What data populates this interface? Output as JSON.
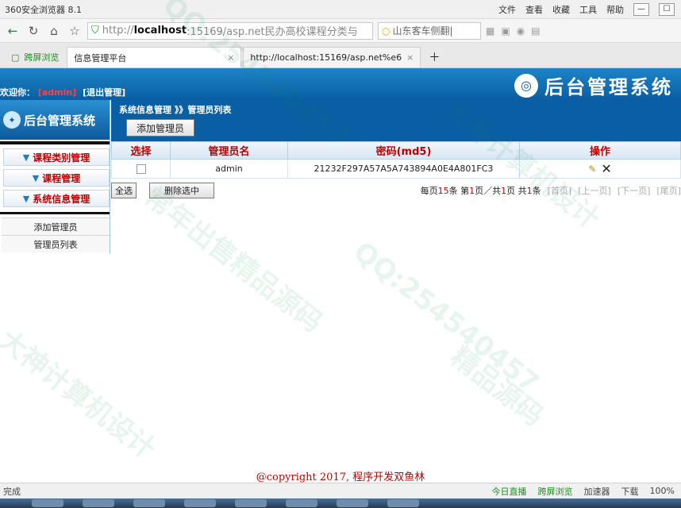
{
  "browser": {
    "app_title": "360安全浏览器 8.1",
    "menu": [
      "文件",
      "查看",
      "收藏",
      "工具",
      "帮助"
    ],
    "address_scheme": "http://",
    "address_host": "localhost",
    "address_rest": ":15169/asp.net民办高校课程分类与",
    "search_text": "山东客车侧翻|",
    "tabs": [
      {
        "label": "跨屏浏览"
      },
      {
        "label": "信息管理平台"
      },
      {
        "label": "http://localhost:15169/asp.net%e6"
      }
    ],
    "status_left": "完成",
    "status_right": [
      "今日直播",
      "跨屏浏览",
      "加速器",
      "下载",
      "100%"
    ]
  },
  "header": {
    "welcome_prefix": "欢迎你：",
    "welcome_user": "[admin]",
    "logout": "[退出管理]",
    "brand_title": "后台管理系统"
  },
  "sidebar": {
    "logo_title": "后台管理系统",
    "categories": [
      {
        "label": "课程类别管理"
      },
      {
        "label": "课程管理"
      },
      {
        "label": "系统信息管理"
      }
    ],
    "links": [
      {
        "label": "添加管理员"
      },
      {
        "label": "管理员列表"
      }
    ]
  },
  "main": {
    "breadcrumb": "系统信息管理 》》管理员列表",
    "add_button": "添加管理员",
    "columns": [
      "选择",
      "管理员名",
      "密码(md5)",
      "操作"
    ],
    "rows": [
      {
        "name": "admin",
        "password_md5": "21232F297A57A5A743894A0E4A801FC3"
      }
    ],
    "select_all": "全选",
    "delete_selected": "删除选中",
    "pager": {
      "per_page_prefix": "每页",
      "per_page": "15",
      "per_page_suffix": "条",
      "page_prefix": "第",
      "current_page": "1",
      "page_mid": "页／共",
      "total_pages": "1",
      "page_suffix": "页",
      "total_prefix": "共",
      "total_records": "1",
      "total_suffix": "条",
      "first": "[首页]",
      "prev": "[上一页]",
      "next": "[下一页]",
      "last": "[尾页]"
    }
  },
  "footer": {
    "copyright": "@copyright 2017, 程序开发双鱼林"
  },
  "watermarks": [
    "QQ:254540457",
    "大神计算机设计",
    "精品源码",
    "常年出售精品源码"
  ],
  "colors": {
    "primary_blue": "#0a5ea3",
    "accent_red": "#c00000",
    "green": "#1a8f1a"
  }
}
